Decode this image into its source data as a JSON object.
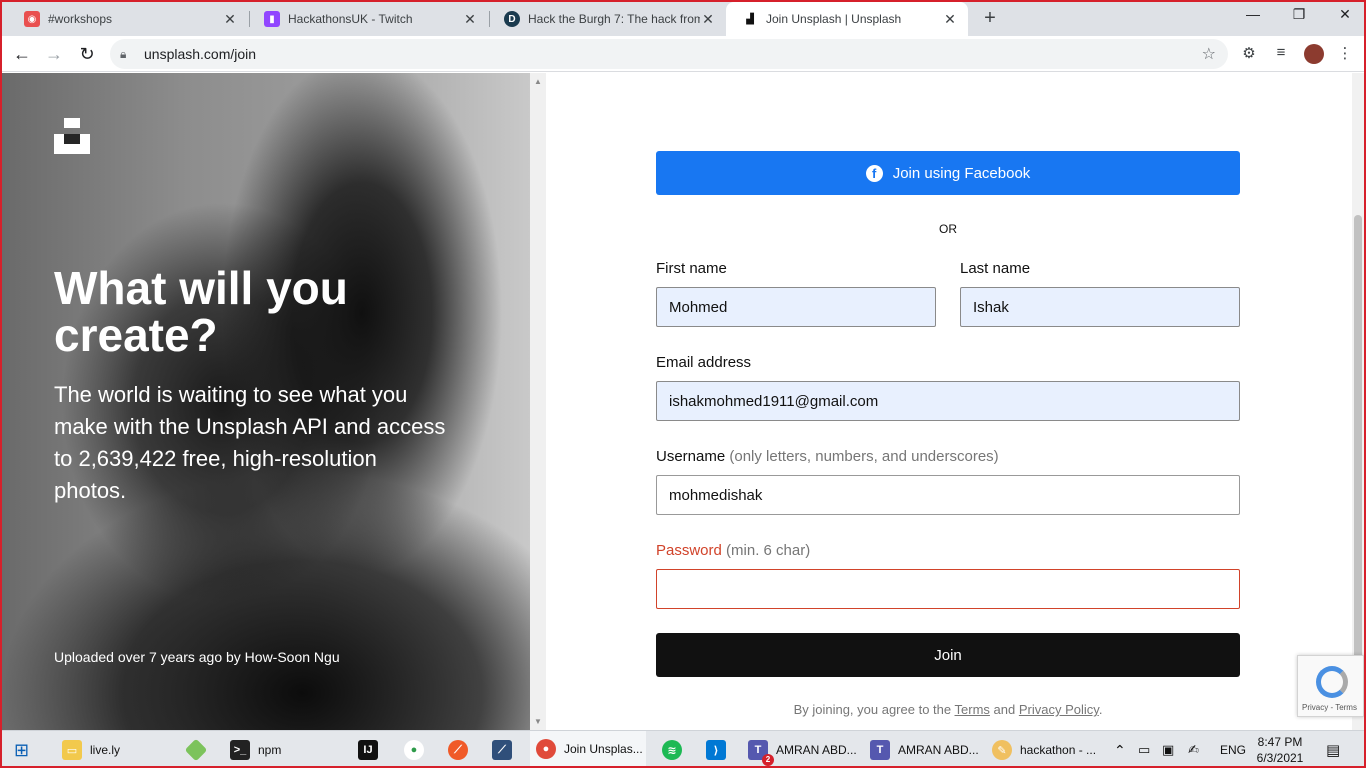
{
  "browser": {
    "tabs": [
      {
        "title": "#workshops",
        "icon": "discord-icon",
        "color": "#e94f4f"
      },
      {
        "title": "HackathonsUK - Twitch",
        "icon": "twitch-icon",
        "color": "#9146ff"
      },
      {
        "title": "Hack the Burgh 7: The hack from",
        "icon": "devpost-icon",
        "color": "#1b3b4f"
      },
      {
        "title": "Join Unsplash | Unsplash",
        "icon": "unsplash-icon",
        "color": "#111111"
      }
    ],
    "url": "unsplash.com/join"
  },
  "hero": {
    "title": "What will you create?",
    "subtitle": "The world is waiting to see what you make with the Unsplash API and access to 2,639,422 free, high-resolution photos.",
    "credit": "Uploaded over 7 years ago by How-Soon Ngu"
  },
  "form": {
    "facebook_label": "Join using Facebook",
    "or_label": "OR",
    "first_name": {
      "label": "First name",
      "value": "Mohmed"
    },
    "last_name": {
      "label": "Last name",
      "value": "Ishak"
    },
    "email": {
      "label": "Email address",
      "value": "ishakmohmed1911@gmail.com"
    },
    "username": {
      "label": "Username",
      "hint": "(only letters, numbers, and underscores)",
      "value": "mohmedishak"
    },
    "password": {
      "label": "Password",
      "hint": "(min. 6 char)",
      "value": ""
    },
    "join_label": "Join",
    "terms": {
      "prefix": "By joining, you agree to the",
      "terms_link": "Terms",
      "and": "and",
      "privacy_link": "Privacy Policy",
      "suffix": "."
    },
    "accent_color": "#1877f2",
    "error_color": "#d1432a"
  },
  "recaptcha": {
    "text": "Privacy - Terms"
  },
  "taskbar": {
    "items": [
      {
        "label": "live.ly",
        "icon": "folder-icon"
      },
      {
        "label": "npm",
        "icon": "terminal-icon"
      },
      {
        "label": "Join Unsplas...",
        "icon": "chrome-icon"
      },
      {
        "label": "AMRAN ABD...",
        "icon": "teams-icon",
        "badge": "2"
      },
      {
        "label": "AMRAN ABD...",
        "icon": "teams-icon"
      },
      {
        "label": "hackathon - ...",
        "icon": "paint-icon"
      }
    ],
    "lang": "ENG",
    "time": "8:47 PM",
    "date": "6/3/2021"
  }
}
